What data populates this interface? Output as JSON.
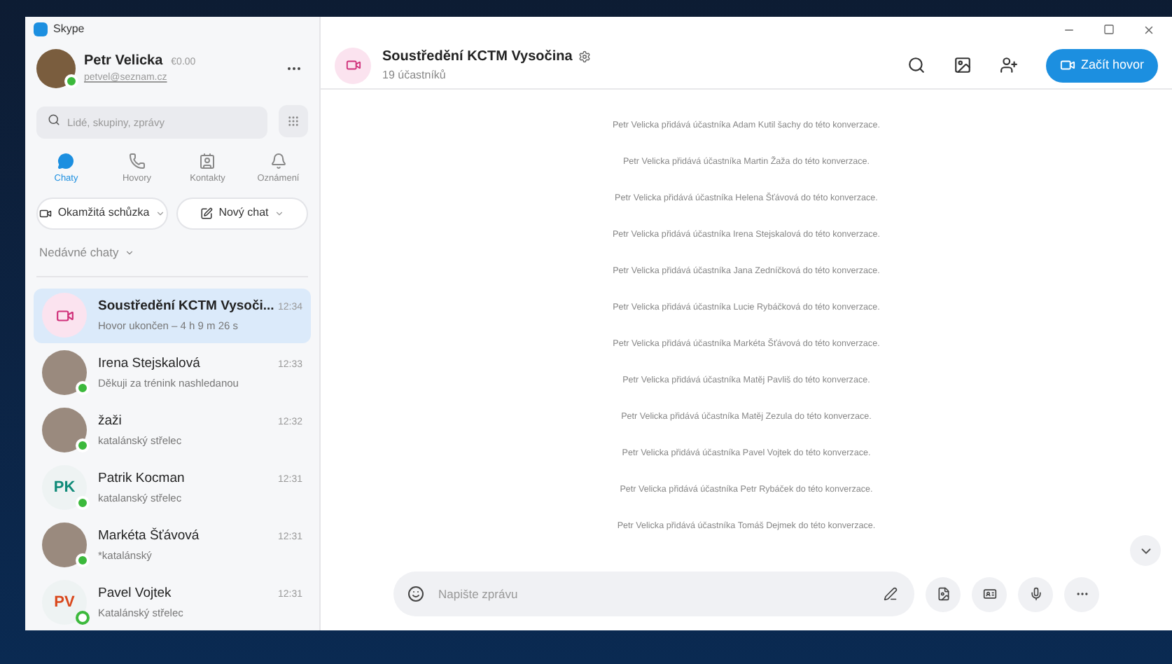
{
  "window": {
    "title": "Skype"
  },
  "profile": {
    "name": "Petr Velicka",
    "balance": "€0.00",
    "email": "petvel@seznam.cz",
    "online": true
  },
  "search": {
    "placeholder": "Lidé, skupiny, zprávy"
  },
  "nav_tabs": [
    {
      "kind": "chats",
      "label": "Chaty",
      "selected": true
    },
    {
      "kind": "calls",
      "label": "Hovory",
      "selected": false
    },
    {
      "kind": "contacts",
      "label": "Kontakty",
      "selected": false
    },
    {
      "kind": "notifications",
      "label": "Oznámení",
      "selected": false
    }
  ],
  "actions": [
    {
      "kind": "meeting",
      "label": "Okamžitá schůzka"
    },
    {
      "kind": "new-chat",
      "label": "Nový chat"
    }
  ],
  "recent_header": "Nedávné chaty",
  "chats": [
    {
      "kind": "group",
      "name": "Soustředění KCTM Vysoči...",
      "preview": "Hovor ukončen – 4 h 9 m 26 s",
      "time": "12:34",
      "selected": true
    },
    {
      "kind": "photo",
      "name": "Irena Stejskalová",
      "preview": "Děkuji za trénink nashledanou",
      "time": "12:33",
      "selected": false,
      "online": true
    },
    {
      "kind": "photo",
      "name": "žaži",
      "preview": "katalánský střelec",
      "time": "12:32",
      "selected": false,
      "online": true
    },
    {
      "kind": "initials",
      "initials": "PK",
      "color": "#0f8a78",
      "name": "Patrik Kocman",
      "preview": "katalanský střelec",
      "time": "12:31",
      "selected": false,
      "online": true
    },
    {
      "kind": "photo",
      "name": "Markéta Šťávová",
      "preview": "*katalánský",
      "time": "12:31",
      "selected": false,
      "online": true
    },
    {
      "kind": "initials",
      "initials": "PV",
      "color": "#d9481c",
      "name": "Pavel Vojtek",
      "preview": "Katalánský střelec",
      "time": "12:31",
      "selected": false,
      "online": false
    }
  ],
  "conversation": {
    "title": "Soustředění KCTM Vysočina",
    "subtitle": "19 účastníků",
    "call_button": "Začít hovor",
    "messages": [
      "Petr Velicka přidává účastníka Adam Kutil  šachy do této konverzace.",
      "Petr Velicka přidává účastníka Martin Žaža do této konverzace.",
      "Petr Velicka přidává účastníka Helena Šťávová do této konverzace.",
      "Petr Velicka přidává účastníka Irena Stejskalová do této konverzace.",
      "Petr Velicka přidává účastníka Jana Zedníčková do této konverzace.",
      "Petr Velicka přidává účastníka Lucie Rybáčková do této konverzace.",
      "Petr Velicka přidává účastníka Markéta Šťávová do této konverzace.",
      "Petr Velicka přidává účastníka Matěj Pavliš do této konverzace.",
      "Petr Velicka přidává účastníka Matěj Zezula do této konverzace.",
      "Petr Velicka přidává účastníka Pavel Vojtek do této konverzace.",
      "Petr Velicka přidává účastníka Petr Rybáček do této konverzace.",
      "Petr Velicka přidává účastníka Tomáš Dejmek do této konverzace."
    ],
    "composer": {
      "placeholder": "Napište zprávu"
    }
  }
}
